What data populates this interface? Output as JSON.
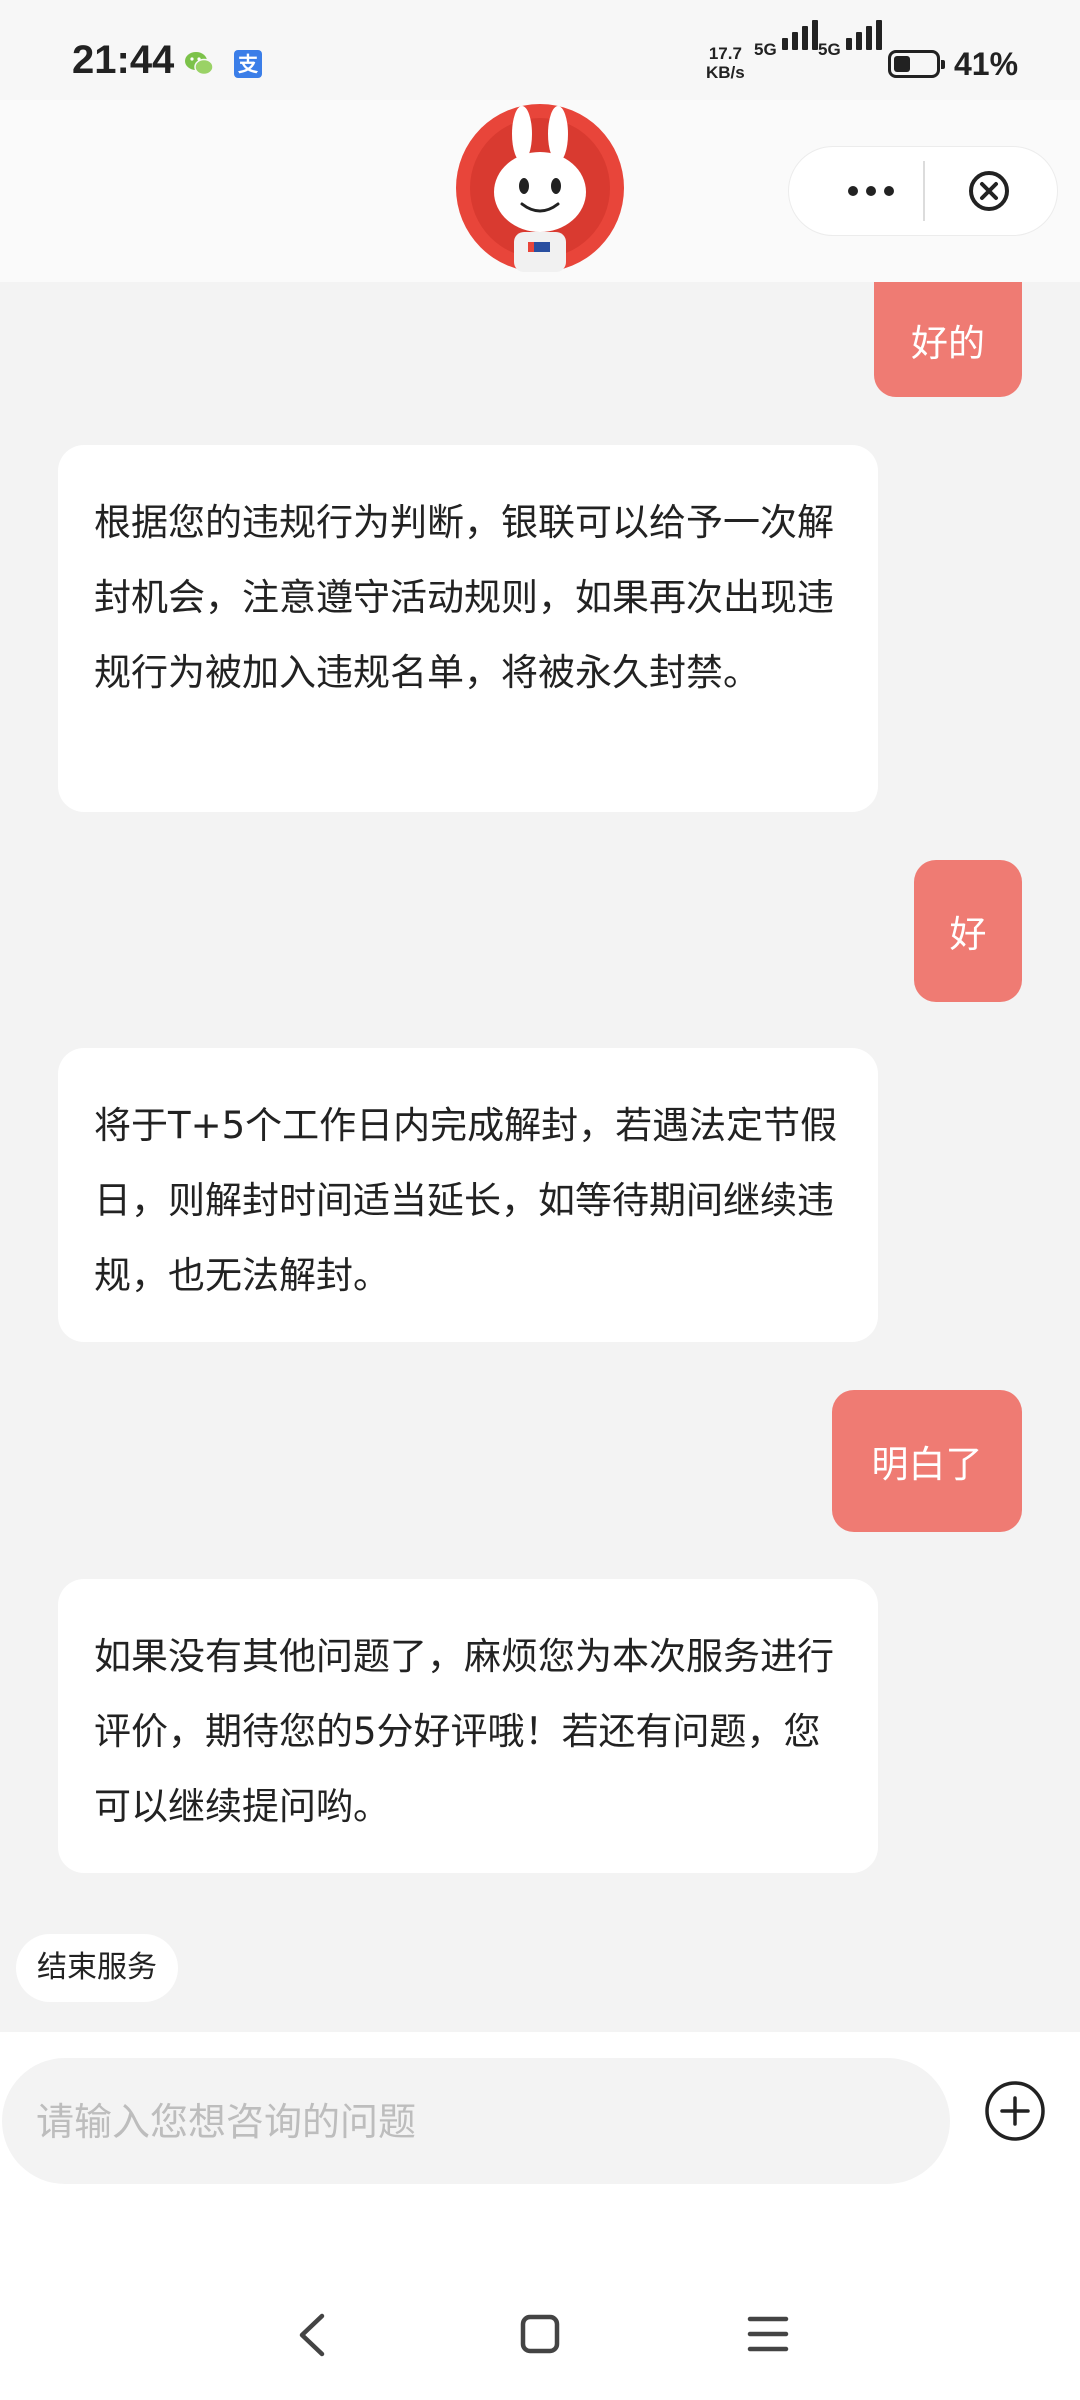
{
  "status_bar": {
    "time": "21:44",
    "net_speed_value": "17.7",
    "net_speed_unit": "KB/s",
    "sim1_label": "5G",
    "sim2_label": "5G",
    "battery_percent": "41%",
    "battery_level": 0.41,
    "app_icons": [
      "wechat-icon",
      "alipay-icon"
    ],
    "alipay_glyph": "支"
  },
  "header": {
    "avatar": "unionpay-rabbit-mascot",
    "more_icon": "ellipsis-icon",
    "close_icon": "close-circle-icon"
  },
  "messages": [
    {
      "role": "user",
      "text": "好的"
    },
    {
      "role": "bot",
      "text": "根据您的违规行为判断，银联可以给予一次解封机会，注意遵守活动规则，如果再次出现违规行为被加入违规名单，将被永久封禁。"
    },
    {
      "role": "user",
      "text": "好"
    },
    {
      "role": "bot",
      "text": "将于T+5个工作日内完成解封，若遇法定节假日，则解封时间适当延长，如等待期间继续违规，也无法解封。"
    },
    {
      "role": "user",
      "text": "明白了"
    },
    {
      "role": "bot",
      "text": "如果没有其他问题了，麻烦您为本次服务进行评价，期待您的5分好评哦！若还有问题，您可以继续提问哟。"
    }
  ],
  "end_service_label": "结束服务",
  "input": {
    "placeholder": "请输入您想咨询的问题",
    "value": ""
  },
  "colors": {
    "user_bubble": "#ef7b73",
    "bot_bubble": "#ffffff",
    "background": "#f3f3f3"
  },
  "navbar": {
    "icons": [
      "back-icon",
      "home-icon",
      "menu-icon"
    ]
  }
}
